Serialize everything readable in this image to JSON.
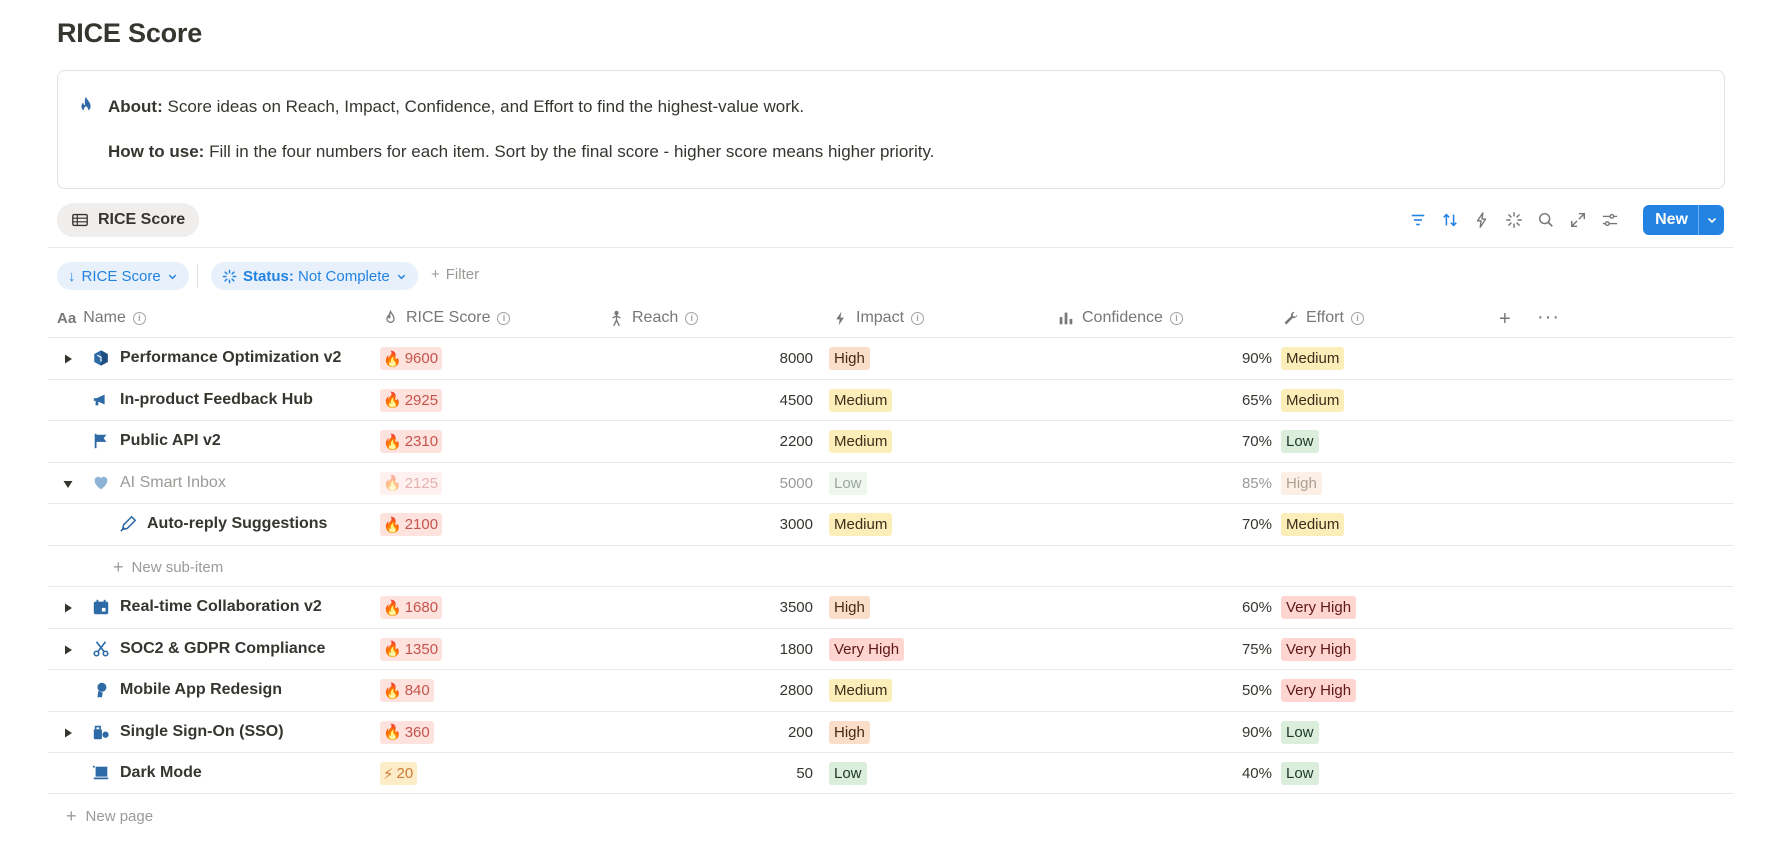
{
  "page": {
    "title": "RICE Score"
  },
  "callout": {
    "icon": "fire-icon",
    "about_label": "About:",
    "about_text": "Score ideas on Reach, Impact, Confidence, and Effort to find the highest-value work.",
    "howto_label": "How to use:",
    "howto_text": "Fill in the four numbers for each item. Sort by the final score - higher score means higher priority."
  },
  "view": {
    "tab_label": "RICE Score"
  },
  "toolbar": {
    "new_label": "New",
    "accent": "#2383e2"
  },
  "filters": {
    "sort_label": "RICE Score",
    "status_key": "Status:",
    "status_value": "Not Complete",
    "add_filter_label": "Filter"
  },
  "columns": {
    "name": "Name",
    "score": "RICE Score",
    "reach": "Reach",
    "impact": "Impact",
    "confidence": "Confidence",
    "effort": "Effort"
  },
  "rows": [
    {
      "name": "Performance Optimization v2",
      "icon": "cube-icon",
      "toggle": "collapsed",
      "score": "9600",
      "score_icon": "🔥",
      "reach": "8000",
      "impact": "High",
      "confidence": "90%",
      "effort": "Medium"
    },
    {
      "name": "In-product Feedback Hub",
      "icon": "megaphone-icon",
      "toggle": "none",
      "score": "2925",
      "score_icon": "🔥",
      "reach": "4500",
      "impact": "Medium",
      "confidence": "65%",
      "effort": "Medium"
    },
    {
      "name": "Public API v2",
      "icon": "flag-icon",
      "toggle": "none",
      "score": "2310",
      "score_icon": "🔥",
      "reach": "2200",
      "impact": "Medium",
      "confidence": "70%",
      "effort": "Low"
    },
    {
      "name": "AI Smart Inbox",
      "icon": "heart-icon",
      "toggle": "expanded",
      "score": "2125",
      "score_icon": "🔥",
      "reach": "5000",
      "impact": "Low",
      "confidence": "85%",
      "effort": "High"
    },
    {
      "name": "Auto-reply Suggestions",
      "icon": "pen-icon",
      "toggle": "none",
      "score": "2100",
      "score_icon": "🔥",
      "reach": "3000",
      "impact": "Medium",
      "confidence": "70%",
      "effort": "Medium"
    },
    {
      "name": "Real-time Collaboration v2",
      "icon": "calendar-icon",
      "toggle": "collapsed",
      "score": "1680",
      "score_icon": "🔥",
      "reach": "3500",
      "impact": "High",
      "confidence": "60%",
      "effort": "Very High"
    },
    {
      "name": "SOC2 & GDPR Compliance",
      "icon": "scissors-icon",
      "toggle": "collapsed",
      "score": "1350",
      "score_icon": "🔥",
      "reach": "1800",
      "impact": "Very High",
      "confidence": "75%",
      "effort": "Very High"
    },
    {
      "name": "Mobile App Redesign",
      "icon": "person-icon",
      "toggle": "none",
      "score": "840",
      "score_icon": "🔥",
      "reach": "2800",
      "impact": "Medium",
      "confidence": "50%",
      "effort": "Very High"
    },
    {
      "name": "Single Sign-On (SSO)",
      "icon": "lock-icon",
      "toggle": "collapsed",
      "score": "360",
      "score_icon": "🔥",
      "reach": "200",
      "impact": "High",
      "confidence": "90%",
      "effort": "Low"
    },
    {
      "name": "Dark Mode",
      "icon": "monitor-icon",
      "toggle": "none",
      "score": "20",
      "score_icon": "⚡",
      "reach": "50",
      "impact": "Low",
      "confidence": "40%",
      "effort": "Low"
    }
  ],
  "new_sub_item_label": "New sub-item",
  "new_page_label": "New page"
}
